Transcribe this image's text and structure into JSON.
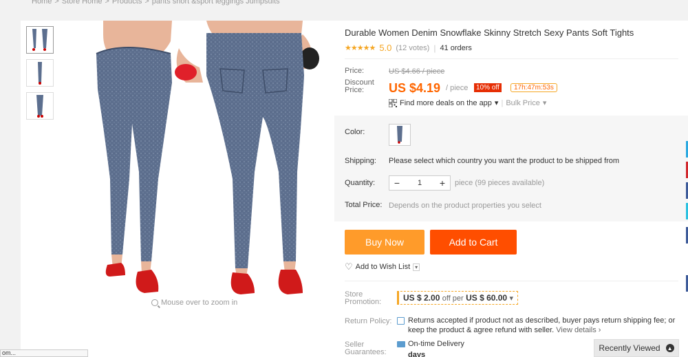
{
  "breadcrumb": {
    "items": [
      "Home",
      "Store Home",
      "Products",
      "pants short &sport leggings Jumpsuits"
    ],
    "separator": ">"
  },
  "gallery": {
    "zoom_hint": "Mouse over to zoom in"
  },
  "product": {
    "title": "Durable Women Denim Snowflake Skinny Stretch Sexy Pants Soft Tights",
    "stars": "★★★★★",
    "rating": "5.0",
    "votes": "(12 votes)",
    "orders": "41 orders"
  },
  "price": {
    "price_label": "Price:",
    "original": "US $4.66 / piece",
    "discount_label_1": "Discount",
    "discount_label_2": "Price:",
    "discount": "US $4.19",
    "per_piece": "/ piece",
    "off_badge": "10% off",
    "timer": "17h:47m:53s",
    "app_deals": "Find more deals on the app",
    "bulk_price": "Bulk Price"
  },
  "options": {
    "color_label": "Color:",
    "shipping_label": "Shipping:",
    "shipping_text": "Please select which country you want the product to be shipped from",
    "quantity_label": "Quantity:",
    "quantity_value": "1",
    "quantity_minus": "−",
    "quantity_plus": "+",
    "quantity_available": "piece (99 pieces available)",
    "total_label": "Total Price:",
    "total_text": "Depends on the product properties you select"
  },
  "actions": {
    "buy_now": "Buy Now",
    "add_to_cart": "Add to Cart",
    "wishlist": "Add to Wish List"
  },
  "store": {
    "promo_label_1": "Store",
    "promo_label_2": "Promotion:",
    "promo_amount": "US $ 2.00",
    "promo_mid": "off per",
    "promo_threshold": "US $ 60.00",
    "return_label": "Return Policy:",
    "return_text": "Returns accepted if product not as described, buyer pays return shipping fee; or keep the product & agree refund with seller.",
    "return_link": "View details ›",
    "guarantee_label_1": "Seller",
    "guarantee_label_2": "Guarantees:",
    "ontime": "On-time Delivery",
    "days": "days"
  },
  "footer": {
    "recently_viewed": "Recently Viewed",
    "status_text": "om..."
  },
  "colors": {
    "accent": "#ff4e00",
    "buy_now": "#ff9b2a",
    "price": "#ff6600",
    "star": "#f5a623"
  },
  "icons": [
    "star-icon",
    "qr-code-icon",
    "heart-icon",
    "zoom-icon",
    "document-icon",
    "truck-icon",
    "chevron-up-icon"
  ]
}
